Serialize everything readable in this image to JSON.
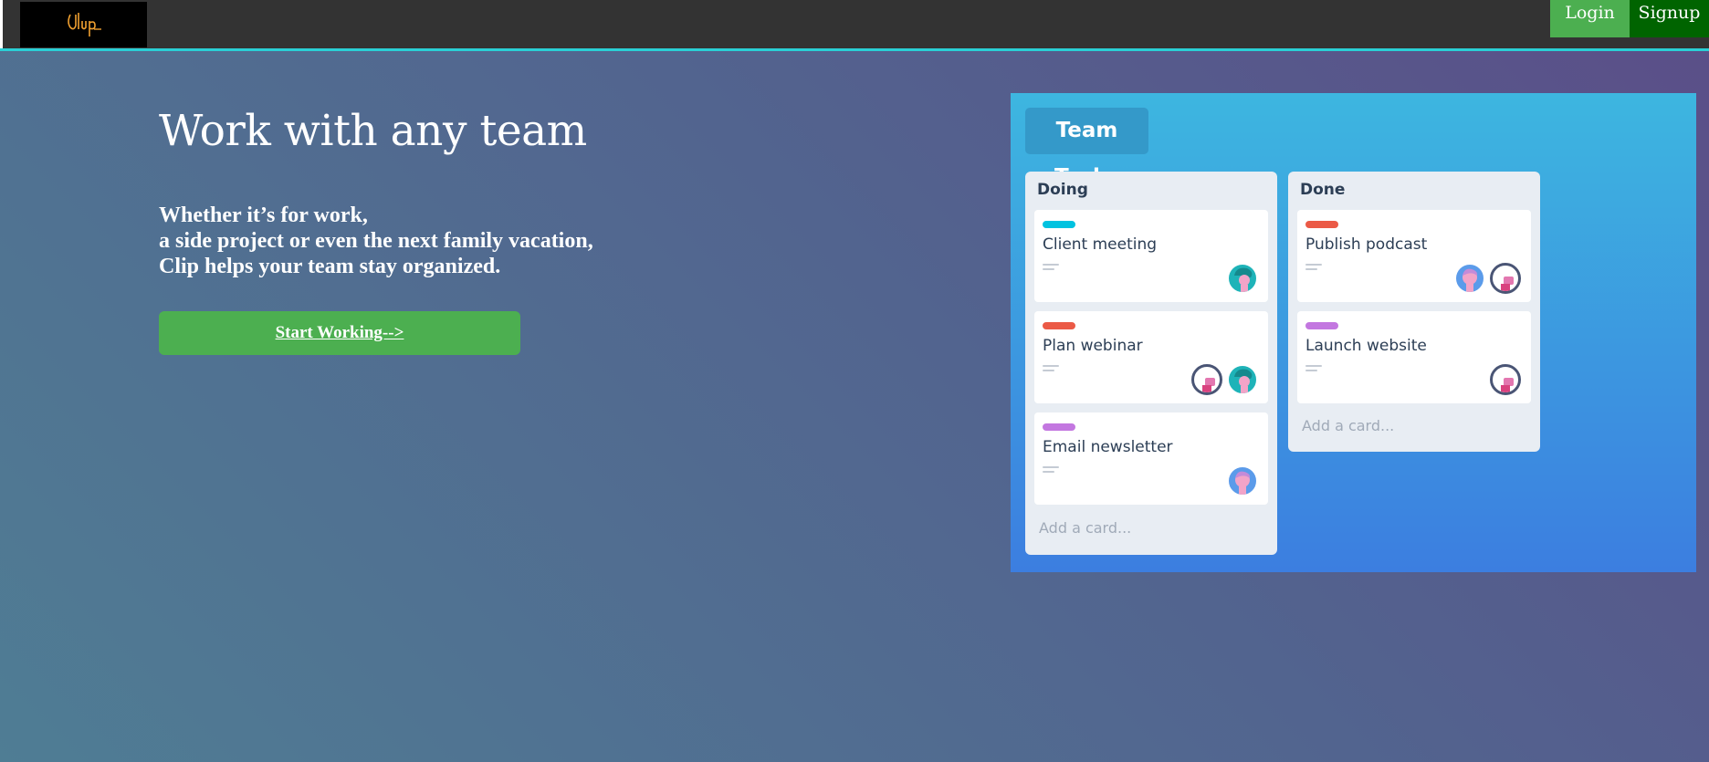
{
  "nav": {
    "logo_text": "Clip",
    "login_label": "Login",
    "signup_label": "Signup"
  },
  "hero": {
    "title": "Work with any team",
    "subtitle_lines": [
      "Whether it’s for work,",
      "a side project or even the next family vacation,",
      "Clip helps your team stay organized."
    ],
    "cta_label": "Start Working-->"
  },
  "board": {
    "title": "Team Tasks",
    "lists": [
      {
        "title": "Doing",
        "add_card": "Add a card...",
        "cards": [
          {
            "label_color": "#00c2e0",
            "title": "Client meeting",
            "avatars": [
              "teal"
            ]
          },
          {
            "label_color": "#eb5a46",
            "title": "Plan webinar",
            "avatars": [
              "outline",
              "teal"
            ]
          },
          {
            "label_color": "#c377e0",
            "title": "Email newsletter",
            "avatars": [
              "blue"
            ]
          }
        ]
      },
      {
        "title": "Done",
        "add_card": "Add a card...",
        "cards": [
          {
            "label_color": "#eb5a46",
            "title": "Publish podcast",
            "avatars": [
              "blue",
              "outline"
            ]
          },
          {
            "label_color": "#c377e0",
            "title": "Launch website",
            "avatars": [
              "outline"
            ]
          }
        ]
      }
    ]
  },
  "colors": {
    "nav_bg": "#333333",
    "nav_accent": "#2ad0d6",
    "login_bg": "#4caf50",
    "signup_bg": "#006400",
    "cta_bg": "#4caf50",
    "logo_color": "#f0a030"
  }
}
